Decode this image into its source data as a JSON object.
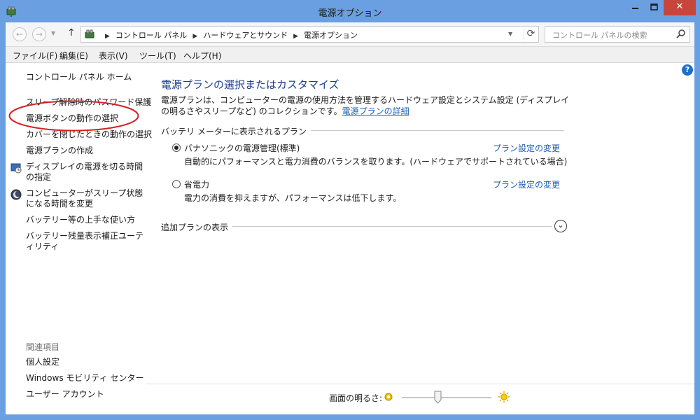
{
  "window": {
    "title": "電源オプション",
    "close_label": "✕",
    "minimize_label": "—",
    "maximize_label": "☐"
  },
  "address": {
    "breadcrumbs": [
      "コントロール パネル",
      "ハードウェアとサウンド",
      "電源オプション"
    ],
    "search_placeholder": "コントロール パネルの検索"
  },
  "menu": {
    "items": [
      "ファイル(F)",
      "編集(E)",
      "表示(V)",
      "ツール(T)",
      "ヘルプ(H)"
    ]
  },
  "sidebar": {
    "home": "コントロール パネル ホーム",
    "links": [
      "スリープ解除時のパスワード保護",
      "電源ボタンの動作の選択",
      "カバーを閉じたときの動作の選択",
      "電源プランの作成",
      "ディスプレイの電源を切る時間の指定",
      "コンピューターがスリープ状態になる時間を変更",
      "バッテリー等の上手な使い方",
      "バッテリー残量表示補正ユーティリティ"
    ],
    "related_title": "関連項目",
    "related": [
      "個人設定",
      "Windows モビリティ センター",
      "ユーザー アカウント"
    ]
  },
  "main": {
    "title": "電源プランの選択またはカスタマイズ",
    "description": "電源プランは、コンピューターの電源の使用方法を管理するハードウェア設定とシステム設定 (ディスプレイの明るさやスリープなど) のコレクションです。",
    "details_link": "電源プランの詳細",
    "section_title": "バッテリ メーターに表示されるプラン",
    "plans": [
      {
        "name": "パナソニックの電源管理(標準)",
        "description": "自動的にパフォーマンスと電力消費のバランスを取ります。(ハードウェアでサポートされている場合)",
        "link": "プラン設定の変更",
        "selected": true
      },
      {
        "name": "省電力",
        "description": "電力の消費を抑えますが、パフォーマンスは低下します。",
        "link": "プラン設定の変更",
        "selected": false
      }
    ],
    "more_plans": "追加プランの表示",
    "brightness_label": "画面の明るさ:",
    "brightness_level": 0.4
  },
  "colors": {
    "titlebar": "#6aa0e2",
    "link": "#1a5fb4",
    "heading": "#1e3d8f",
    "highlight": "#d32222"
  },
  "icons": [
    "power-options-icon",
    "search-icon",
    "refresh-icon",
    "help-icon",
    "display-clock-icon",
    "moon-icon",
    "dim-sun-icon",
    "bright-sun-icon",
    "expand-chevron-icon"
  ]
}
